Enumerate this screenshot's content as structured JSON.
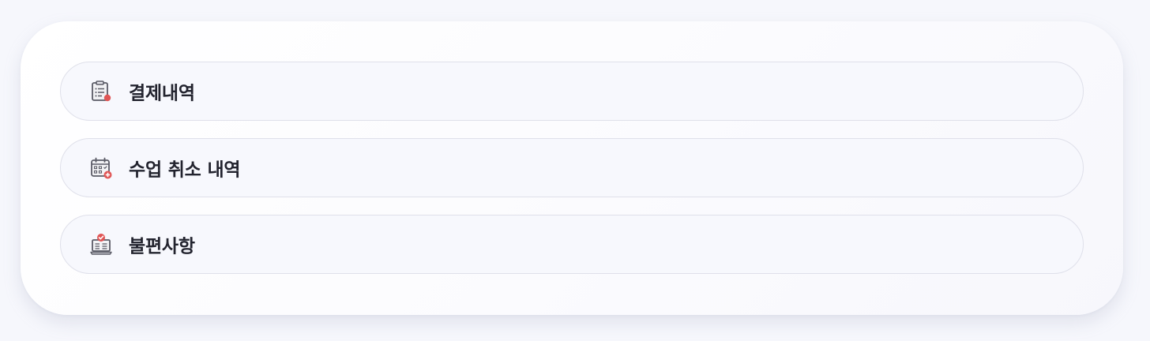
{
  "menu": {
    "items": [
      {
        "label": "결제내역",
        "icon": "clipboard-list-icon"
      },
      {
        "label": "수업 취소 내역",
        "icon": "calendar-plus-icon"
      },
      {
        "label": "불편사항",
        "icon": "laptop-check-icon"
      }
    ]
  },
  "colors": {
    "page_background": "#f6f7fc",
    "card_background": "#ffffff",
    "item_background": "#f7f8fd",
    "item_border": "#dfe0ea",
    "label_text": "#22232e",
    "icon_stroke": "#5a5b66",
    "icon_accent": "#e05555"
  }
}
